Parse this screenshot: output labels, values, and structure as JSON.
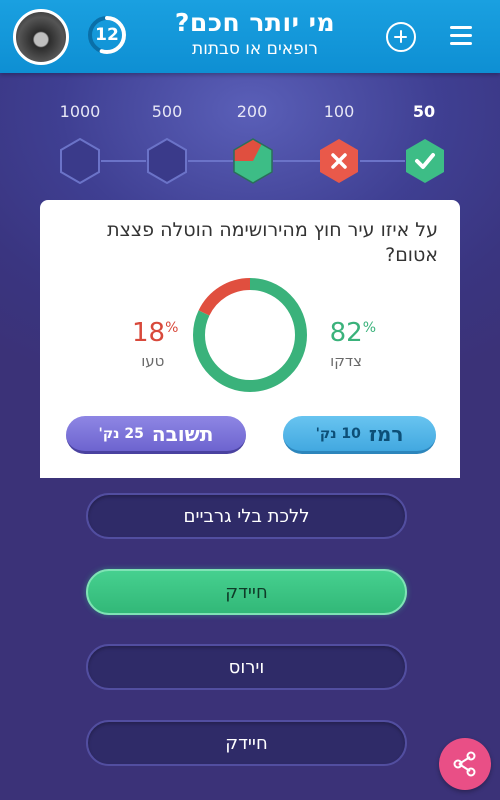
{
  "header": {
    "title": "מי יותר חכם?",
    "subtitle": "רופאים או סבתות",
    "level": "12",
    "level_progress": 0.55,
    "accent": "#1aa0e0"
  },
  "ladder": {
    "steps": [
      {
        "value": "1000",
        "state": "locked"
      },
      {
        "value": "500",
        "state": "locked"
      },
      {
        "value": "200",
        "state": "current"
      },
      {
        "value": "100",
        "state": "wrong"
      },
      {
        "value": "50",
        "state": "correct"
      }
    ]
  },
  "question": {
    "text": "על איזו עיר חוץ מהירושימה הוטלה פצצת אטום?",
    "correct_pct": 82,
    "wrong_pct": 18,
    "correct_label": "צדקו",
    "wrong_label": "טעו",
    "correct_pct_text": "82",
    "wrong_pct_text": "18",
    "pct_sign": "%",
    "correct_color": "#3ab27b",
    "wrong_color": "#e04f3f"
  },
  "actions": {
    "hint_label": "רמז",
    "hint_cost": "10 נק'",
    "answer_label": "תשובה",
    "answer_cost": "25 נק'"
  },
  "options": [
    {
      "label": "ללכת בלי גרביים",
      "state": "normal"
    },
    {
      "label": "חיידק",
      "state": "correct"
    },
    {
      "label": "וירוס",
      "state": "normal"
    },
    {
      "label": "חיידק",
      "state": "normal"
    }
  ],
  "icons": {
    "share": "share-icon",
    "plus": "plus-icon",
    "menu": "hamburger-menu-icon"
  }
}
